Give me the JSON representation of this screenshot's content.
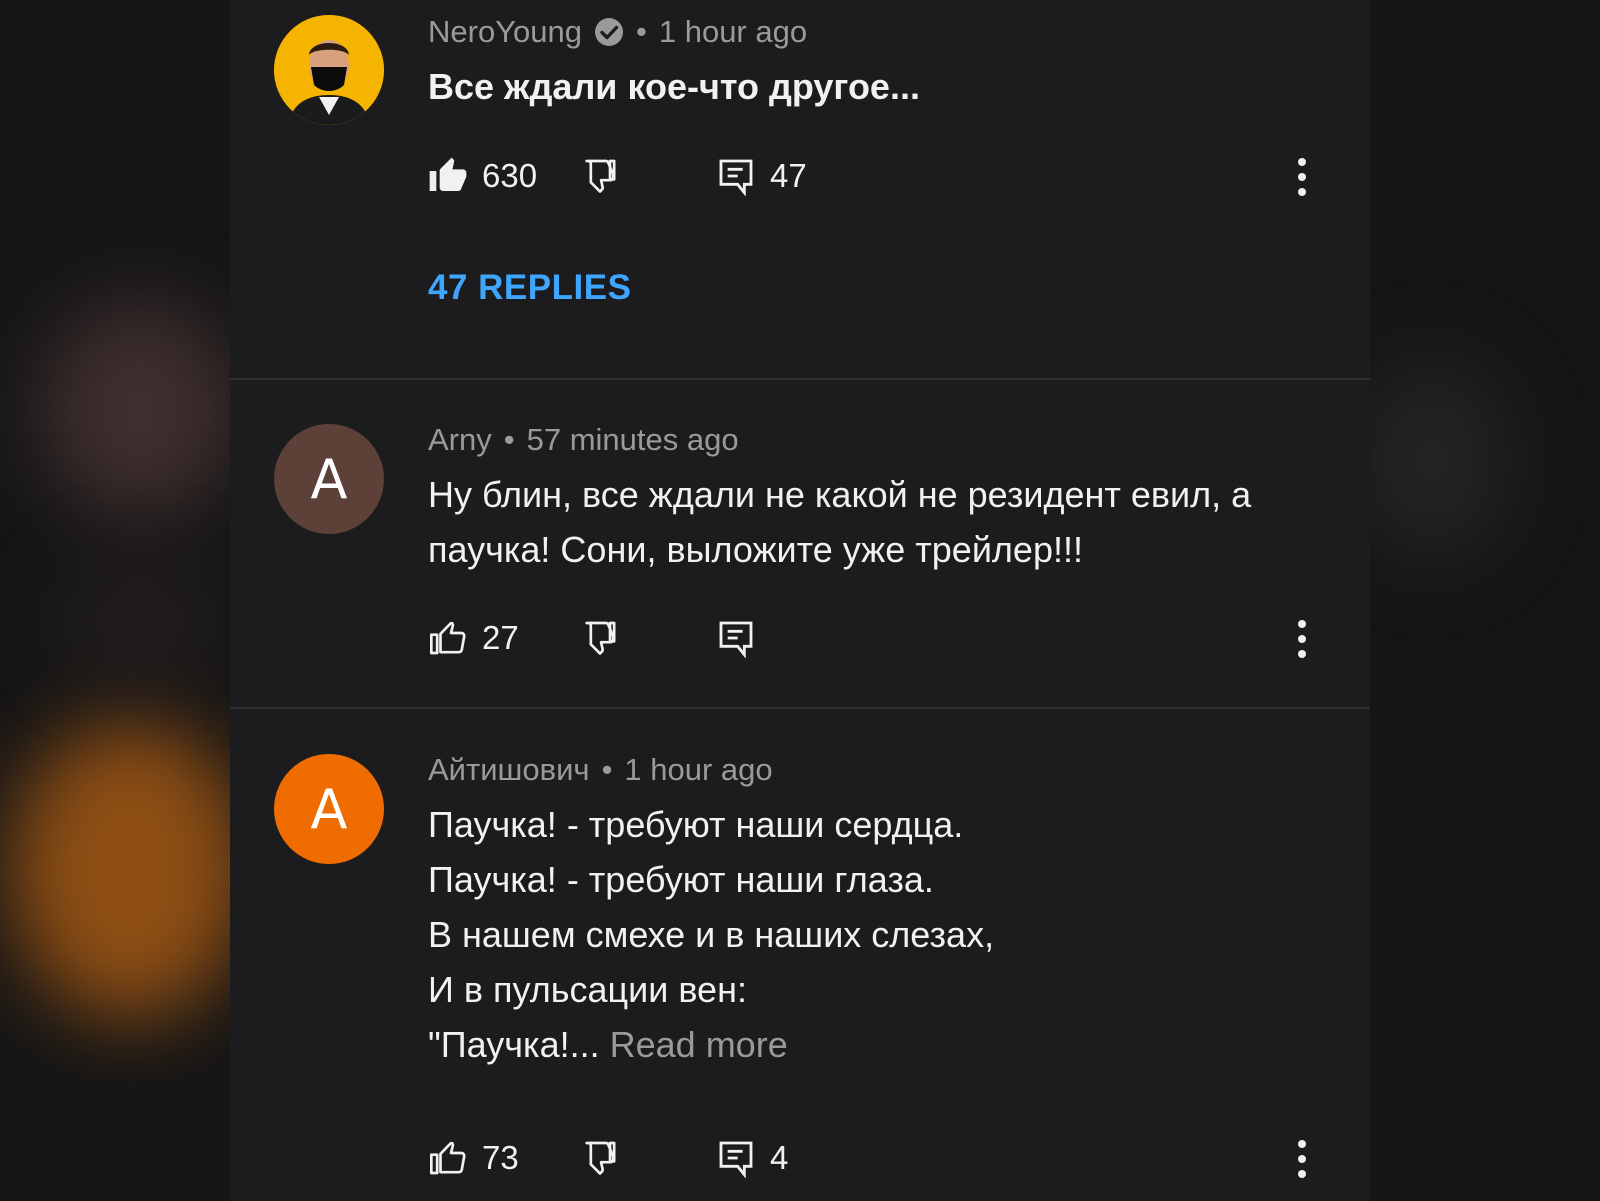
{
  "comments": [
    {
      "author": "NeroYoung",
      "verified": true,
      "separator": "•",
      "time": "1 hour ago",
      "lines": [
        "Все ждали кое-что другое..."
      ],
      "read_more": "",
      "likes": "630",
      "liked": true,
      "reply_count": "47",
      "replies_link": "47 REPLIES",
      "avatar_color": "#f5b400"
    },
    {
      "author": "Arny",
      "separator": "•",
      "time": "57 minutes ago",
      "avatar_letter": "A",
      "avatar_color": "#5d4037",
      "lines": [
        "Ну блин, все ждали не какой не резидент евил, а",
        "паучка! Сони, выложите уже трейлер!!!"
      ],
      "likes": "27",
      "liked": false,
      "reply_count": ""
    },
    {
      "author": "Айтишович",
      "separator": "•",
      "time": "1 hour ago",
      "avatar_letter": "A",
      "avatar_color": "#ef6c00",
      "lines": [
        "Паучка! - требуют наши сердца.",
        "Паучка! - требуют наши глаза.",
        "В нашем смехе и в наших слезах,",
        "И в пульсации вен:",
        "\"Паучка!..."
      ],
      "read_more": "Read more",
      "likes": "73",
      "liked": false,
      "reply_count": "4"
    }
  ],
  "icons": {
    "like": "thumb-up-icon",
    "dislike": "thumb-down-icon",
    "reply": "comment-reply-icon",
    "more": "more-vert-icon",
    "verified": "verified-check-icon"
  },
  "colors": {
    "link": "#3ea6ff",
    "panel": "#1c1c1e",
    "meta_text": "#9a9a9a"
  }
}
